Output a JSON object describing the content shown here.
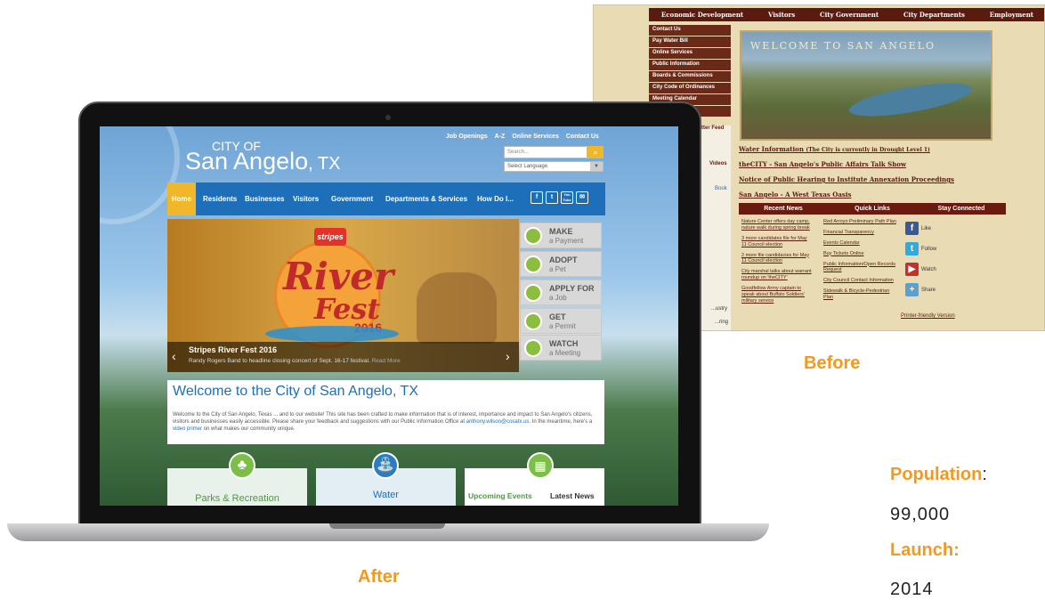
{
  "before": {
    "top_nav": [
      "Economic Development",
      "Visitors",
      "City Government",
      "City Departments",
      "Employment"
    ],
    "left_menu": [
      "Contact Us",
      "Pay Water Bill",
      "Online Services",
      "Public Information",
      "Boards & Commissions",
      "City Code of Ordinances",
      "Meeting Calendar",
      "...ation"
    ],
    "welcome_text": "WELCOME TO SAN ANGELO",
    "feed_label": "...tter Feed",
    "videos_label": "Videos",
    "book_label": "Book",
    "industry_label": "...ustry",
    "ring_label": "...ring",
    "links": [
      {
        "title": "Water Information",
        "note": "(The City is currently in Drought Level 1)"
      },
      {
        "title": "theCITY - San Angelo's Public Affairs Talk Show",
        "note": ""
      },
      {
        "title": "Notice of Public Hearing to Institute Annexation Proceedings",
        "note": ""
      },
      {
        "title": "San Angelo - A West Texas Oasis",
        "note": ""
      }
    ],
    "columns": [
      "Recent News",
      "Quick Links",
      "Stay Connected"
    ],
    "recent_news": [
      "Nature Center offers day camp, nature walk during spring break",
      "3 more candidates file for May 11 Council election",
      "2 more file candidacies for May 11 Council election",
      "City marshal talks about warrant roundup on 'theCITY'",
      "Goodfellow Army captain to speak about Buffalo Soldiers' military service"
    ],
    "quick_links": [
      "Red Arroyo Preliminary Path Plan",
      "Financial Transparency",
      "Events Calendar",
      "Buy Tickets Online",
      "Public Information/Open Records Request",
      "City Council Contact Information",
      "Sidewalk & Bicycle-Pedestrian Plan"
    ],
    "social": [
      "Like",
      "Follow",
      "Watch",
      "Share"
    ],
    "printer_link": "Printer-friendly Version"
  },
  "captions": {
    "before": "Before",
    "after": "After"
  },
  "stats": {
    "population_label": "Population",
    "population_colon": ":",
    "population_value": "99,000",
    "launch_label": "Launch:",
    "launch_value": "2014"
  },
  "after": {
    "utility_links": [
      "Job Openings",
      "A-Z",
      "Online Services",
      "Contact Us"
    ],
    "logo_small": "CITY OF",
    "logo_big": "San Angelo",
    "logo_state": ", TX",
    "search_placeholder": "Search...",
    "language_value": "Select Language",
    "nav": [
      "Home",
      "Residents",
      "Businesses",
      "Visitors",
      "Government",
      "Departments & Services",
      "How Do I..."
    ],
    "social_icons": [
      "f",
      "t",
      "You Tube",
      "✉"
    ],
    "hero_badge": "stripes",
    "hero_title_1": "River",
    "hero_title_2": "Fest",
    "hero_year": "2016",
    "slide_title": "Stripes River Fest 2016",
    "slide_text": "Randy Rogers Band to headline closing concert of Sept. 16-17 festival.",
    "slide_more": "Read More",
    "quick_actions": [
      {
        "l1": "MAKE",
        "l2": "a Payment"
      },
      {
        "l1": "ADOPT",
        "l2": "a Pet"
      },
      {
        "l1": "APPLY FOR",
        "l2": "a Job"
      },
      {
        "l1": "GET",
        "l2": "a Permit"
      },
      {
        "l1": "WATCH",
        "l2": "a Meeting"
      }
    ],
    "welcome_title": "Welcome to the City of San Angelo, TX",
    "welcome_body_1": "Welcome to the City of San Angelo, Texas ... and to our website! This site has been crafted to make information that is of interest, importance and impact to San Angelo's citizens, visitors and businesses easily accessible. Please share your feedback and suggestions with our Public Information Office at ",
    "welcome_email": "anthony.wilson@cosatx.us",
    "welcome_body_2": ". In the meantime, here's a ",
    "welcome_video": "video primer",
    "welcome_body_3": " on what makes our community unique.",
    "cards": [
      "Parks & Recreation",
      "Water",
      "Upcoming Events",
      "Latest News"
    ]
  }
}
